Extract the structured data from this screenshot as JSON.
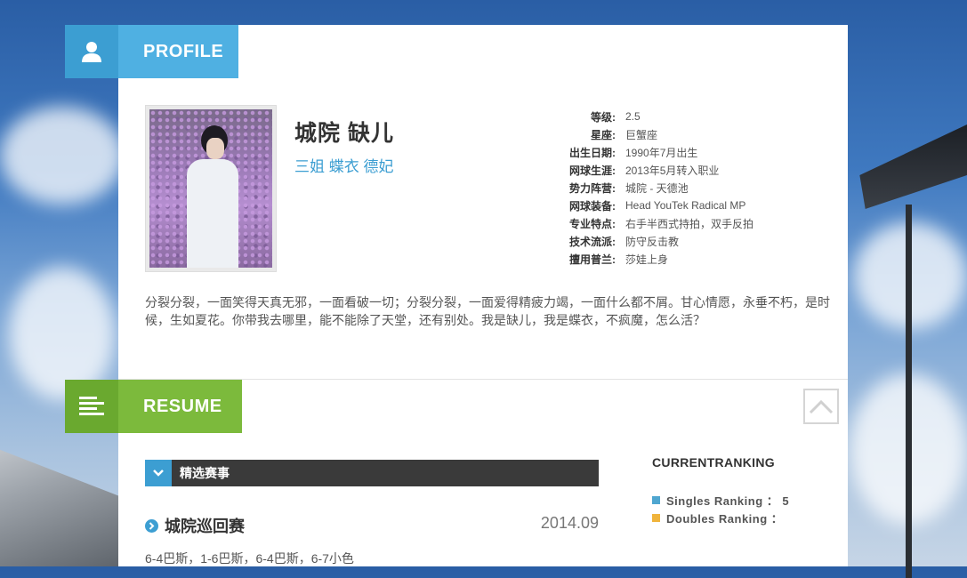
{
  "profile_header": {
    "label": "PROFILE",
    "icon": "user-icon"
  },
  "resume_header": {
    "label": "RESUME",
    "icon": "list-icon"
  },
  "profile": {
    "name": "城院  缺儿",
    "alias": "三姐 蝶衣 德妃",
    "info": [
      {
        "key": "等级:",
        "value": "2.5"
      },
      {
        "key": "星座:",
        "value": "巨蟹座"
      },
      {
        "key": "出生日期:",
        "value": "1990年7月出生"
      },
      {
        "key": "网球生涯:",
        "value": "2013年5月转入职业"
      },
      {
        "key": "势力阵营:",
        "value": "城院 - 天德池"
      },
      {
        "key": "网球装备:",
        "value": "Head YouTek Radical MP"
      },
      {
        "key": "专业特点:",
        "value": "右手半西式持拍，双手反拍"
      },
      {
        "key": "技术流派:",
        "value": "防守反击教"
      },
      {
        "key": "擅用普兰:",
        "value": "莎娃上身"
      }
    ],
    "bio": "分裂分裂，一面笑得天真无邪，一面看破一切；分裂分裂，一面爱得精疲力竭，一面什么都不屑。甘心情愿，永垂不朽，是时候，生如夏花。你带我去哪里，能不能除了天堂，还有别处。我是缺儿，我是蝶衣，不疯魔，怎么活？"
  },
  "resume": {
    "section_label": "精选赛事",
    "events": [
      {
        "title": "城院巡回赛",
        "date": "2014.09",
        "score": "6-4巴斯，1-6巴斯，6-4巴斯，6-7小色"
      }
    ]
  },
  "ranking": {
    "title": "CURRENTRANKING",
    "items": [
      {
        "label": "Singles  Ranking ： 5",
        "color": "#4fa6d0"
      },
      {
        "label": "Doubles  Ranking ：",
        "color": "#f0b43c"
      }
    ]
  },
  "colors": {
    "blue": "#4fb0e2",
    "green": "#7cba3c",
    "dark_bar": "#3a3a3a"
  }
}
